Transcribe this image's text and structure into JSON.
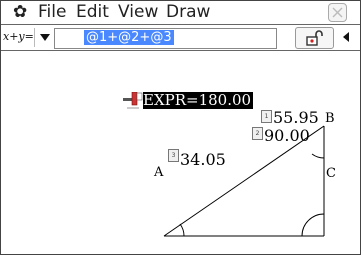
{
  "app": {
    "menu": [
      "File",
      "Edit",
      "View",
      "Draw"
    ],
    "xy_label": "x+y="
  },
  "expression": {
    "value": "@1+@2+@3"
  },
  "readout": {
    "text": "EXPR=180.00"
  },
  "measurements": {
    "angle_b": "55.95",
    "angle_c": "90.00",
    "angle_a": "34.05"
  },
  "vertices": {
    "a": "A",
    "b": "B",
    "c": "C"
  },
  "tags": [
    "1",
    "2",
    "3"
  ],
  "colors": {
    "selection": "#4a88ff",
    "readout_bg": "#000000",
    "lock_red": "#d22222"
  }
}
